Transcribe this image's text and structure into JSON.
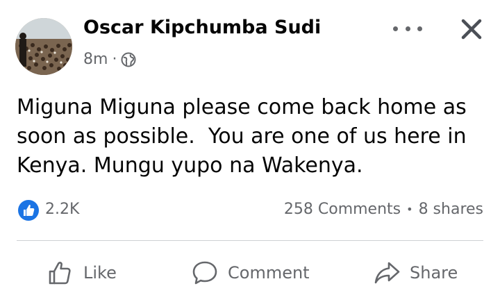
{
  "post": {
    "author": "Oscar Kipchumba Sudi",
    "time": "8m",
    "separator": "·",
    "privacy_icon": "globe-icon",
    "lines": [
      "Miguna Miguna please come back home as",
      "soon as possible.  You are one of us here in",
      "Kenya. Mungu yupo na Wakenya."
    ]
  },
  "stats": {
    "reactions": "2.2K",
    "comments": "258 Comments",
    "dot": "•",
    "shares": "8 shares"
  },
  "actions": {
    "like": "Like",
    "comment": "Comment",
    "share": "Share"
  },
  "colors": {
    "accent": "#1b74e4",
    "muted": "#65676b",
    "text": "#050505",
    "divider": "#ced0d4"
  }
}
